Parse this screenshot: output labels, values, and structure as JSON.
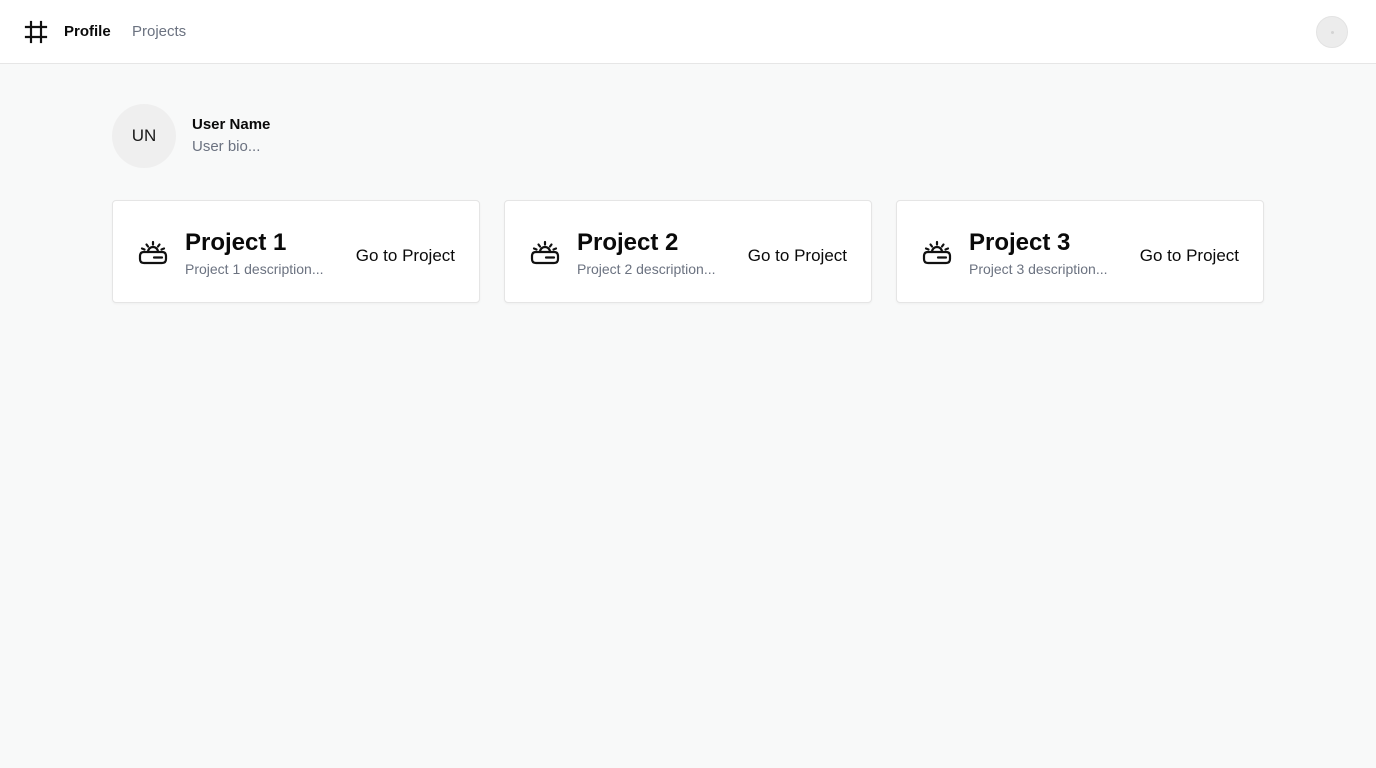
{
  "header": {
    "logo_icon": "hash-frame-icon",
    "nav": [
      {
        "label": "Profile",
        "active": true
      },
      {
        "label": "Projects",
        "active": false
      }
    ],
    "user_avatar_icon": "user-avatar-icon"
  },
  "profile": {
    "initials": "UN",
    "name": "User Name",
    "bio": "User bio..."
  },
  "projects": [
    {
      "title": "Project 1",
      "description": "Project 1 description...",
      "button_label": "Go to Project",
      "icon": "radio-device-icon"
    },
    {
      "title": "Project 2",
      "description": "Project 2 description...",
      "button_label": "Go to Project",
      "icon": "radio-device-icon"
    },
    {
      "title": "Project 3",
      "description": "Project 3 description...",
      "button_label": "Go to Project",
      "icon": "radio-device-icon"
    }
  ],
  "colors": {
    "background": "#f8f9f9",
    "surface": "#ffffff",
    "text_primary": "#0a0a0a",
    "text_muted": "#6b7280",
    "border": "#e5e5e5"
  }
}
